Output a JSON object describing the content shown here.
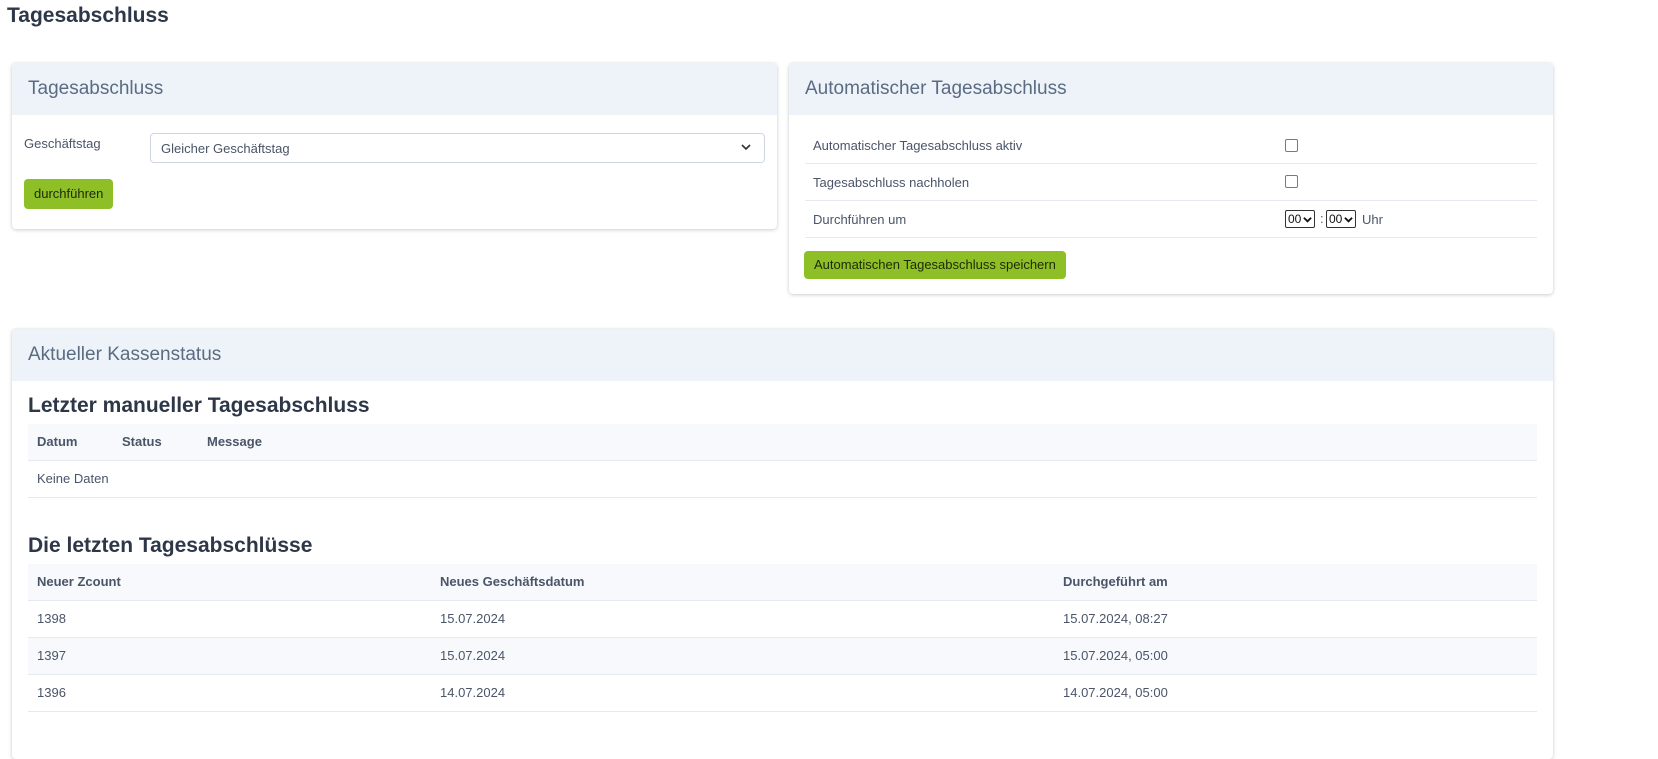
{
  "page": {
    "title": "Tagesabschluss"
  },
  "manual_card": {
    "header": "Tagesabschluss",
    "business_day_label": "Geschäftstag",
    "business_day_value": "Gleicher Geschäftstag",
    "execute_button": "durchführen"
  },
  "auto_card": {
    "header": "Automatischer Tagesabschluss",
    "active_label": "Automatischer Tagesabschluss aktiv",
    "catchup_label": "Tagesabschluss nachholen",
    "run_at_label": "Durchführen um",
    "hour_value": "00",
    "minute_value": "00",
    "time_separator": ":",
    "time_unit": "Uhr",
    "save_button": "Automatischen Tagesabschluss speichern"
  },
  "status_card": {
    "header": "Aktueller Kassenstatus",
    "last_manual": {
      "title": "Letzter manueller Tagesabschluss",
      "columns": [
        "Datum",
        "Status",
        "Message"
      ],
      "empty_text": "Keine Daten"
    },
    "recent": {
      "title": "Die letzten Tagesabschlüsse",
      "columns": [
        "Neuer Zcount",
        "Neues Geschäftsdatum",
        "Durchgeführt am"
      ],
      "rows": [
        [
          "1398",
          "15.07.2024",
          "15.07.2024, 08:27"
        ],
        [
          "1397",
          "15.07.2024",
          "15.07.2024, 05:00"
        ],
        [
          "1396",
          "14.07.2024",
          "14.07.2024, 05:00"
        ]
      ]
    }
  },
  "colors": {
    "accent_green": "#8fbf26",
    "card_header_bg": "#eef3fa",
    "table_alt_bg": "#f7f9fc"
  }
}
